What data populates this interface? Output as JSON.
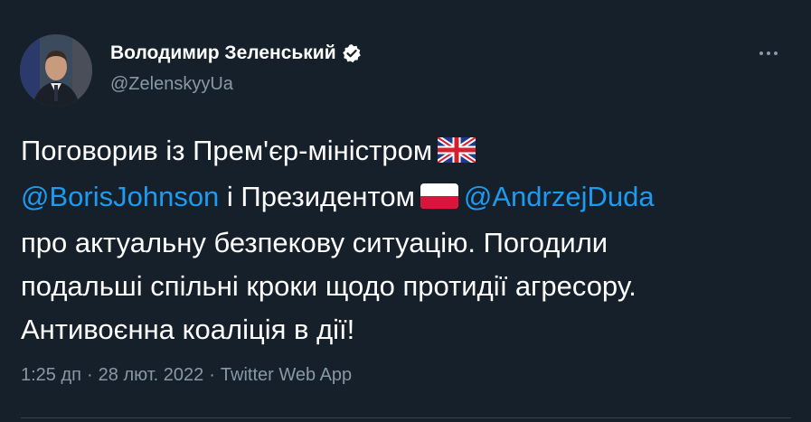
{
  "author": {
    "display_name": "Володимир Зеленський",
    "handle": "@ZelenskyyUa"
  },
  "tweet": {
    "line1_text": "Поговорив із Прем'єр-міністром",
    "mention1": "@BorisJohnson",
    "line2_mid": " і Президентом",
    "mention2": "@AndrzejDuda",
    "line3": "про актуальну безпекову ситуацію. Погодили",
    "line4": "подальші спільні кроки щодо протидії агресору.",
    "line5": "Антивоєнна коаліція в дії!"
  },
  "meta": {
    "time": "1:25 дп",
    "date": "28 лют. 2022",
    "source": "Twitter Web App",
    "separator": "·"
  },
  "icons": {
    "verified": "verified-badge-icon",
    "more": "more-options-icon",
    "flag_uk": "uk-flag-icon",
    "flag_pl": "poland-flag-icon"
  },
  "colors": {
    "background": "#15202b",
    "mention": "#1d9bf0",
    "secondary_text": "#8899a6"
  }
}
